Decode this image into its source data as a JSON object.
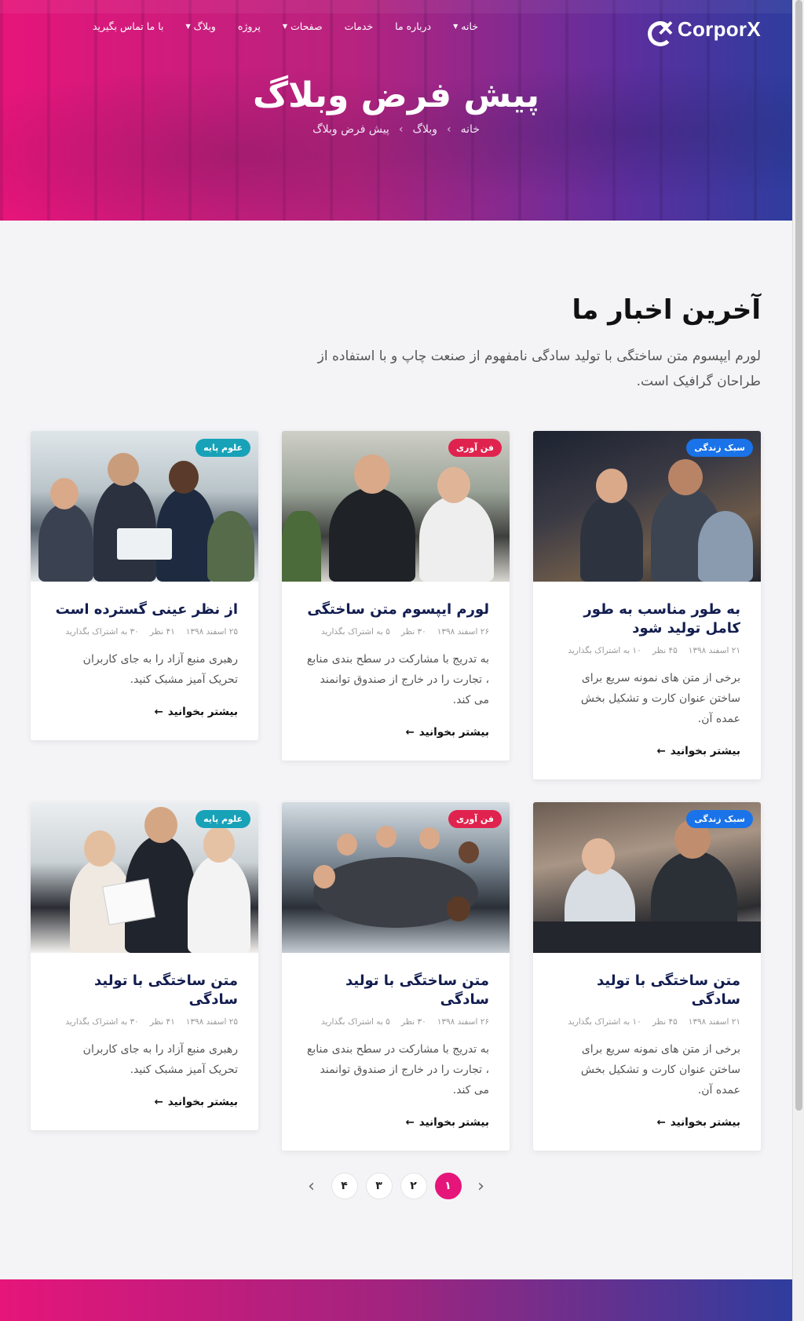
{
  "brand": {
    "name": "CorporX"
  },
  "nav": [
    {
      "label": "خانه",
      "dropdown": true
    },
    {
      "label": "درباره ما",
      "dropdown": false
    },
    {
      "label": "خدمات",
      "dropdown": false
    },
    {
      "label": "صفحات",
      "dropdown": true
    },
    {
      "label": "پروژه",
      "dropdown": false
    },
    {
      "label": "وبلاگ",
      "dropdown": true
    },
    {
      "label": "با ما تماس بگیرید",
      "dropdown": false
    }
  ],
  "hero": {
    "title": "پیش فرض وبلاگ",
    "breadcrumb": [
      "خانه",
      "وبلاگ",
      "پیش فرض وبلاگ"
    ]
  },
  "section": {
    "title": "آخرین اخبار ما",
    "subtitle": "لورم ایپسوم متن ساختگی با تولید سادگی نامفهوم از صنعت چاپ و با استفاده از طراحان گرافیک است."
  },
  "read_more": "بیشتر بخوانید",
  "posts": [
    {
      "badge": "سبک زندگی",
      "badge_color": "#1a73e8",
      "title": "به طور مناسب به طور کامل تولید شود",
      "date": "۲۱ اسفند ۱۳۹۸",
      "comments": "۴۵ نظر",
      "shares": "۱۰ به اشتراک بگذارید",
      "excerpt": "برخی از متن های نمونه سریع برای ساختن عنوان کارت و تشکیل بخش عمده آن."
    },
    {
      "badge": "فن آوری",
      "badge_color": "#e0234e",
      "title": "لورم ایپسوم متن ساختگی",
      "date": "۲۶ اسفند ۱۳۹۸",
      "comments": "۳۰ نظر",
      "shares": "۵ به اشتراک بگذارید",
      "excerpt": "به تدریج با مشارکت در سطح بندی منابع ، تجارت را در خارج از صندوق توانمند می کند."
    },
    {
      "badge": "علوم پایه",
      "badge_color": "#17a2b8",
      "title": "از نظر عینی گسترده است",
      "date": "۲۵ اسفند ۱۳۹۸",
      "comments": "۴۱ نظر",
      "shares": "۳۰ به اشتراک بگذارید",
      "excerpt": "رهبری منبع آزاد را به جای کاربران تحریک آمیز مشبک کنید."
    },
    {
      "badge": "سبک زندگی",
      "badge_color": "#1a73e8",
      "title": "متن ساختگی با تولید سادگی",
      "date": "۲۱ اسفند ۱۳۹۸",
      "comments": "۴۵ نظر",
      "shares": "۱۰ به اشتراک بگذارید",
      "excerpt": "برخی از متن های نمونه سریع برای ساختن عنوان کارت و تشکیل بخش عمده آن."
    },
    {
      "badge": "فن آوری",
      "badge_color": "#e0234e",
      "title": "متن ساختگی با تولید سادگی",
      "date": "۲۶ اسفند ۱۳۹۸",
      "comments": "۳۰ نظر",
      "shares": "۵ به اشتراک بگذارید",
      "excerpt": "به تدریج با مشارکت در سطح بندی منابع ، تجارت را در خارج از صندوق توانمند می کند."
    },
    {
      "badge": "علوم پایه",
      "badge_color": "#17a2b8",
      "title": "متن ساختگی با تولید سادگی",
      "date": "۲۵ اسفند ۱۳۹۸",
      "comments": "۴۱ نظر",
      "shares": "۳۰ به اشتراک بگذارید",
      "excerpt": "رهبری منبع آزاد را به جای کاربران تحریک آمیز مشبک کنید."
    }
  ],
  "pagination": {
    "pages": [
      "۱",
      "۲",
      "۳",
      "۴"
    ],
    "current": "۱"
  }
}
